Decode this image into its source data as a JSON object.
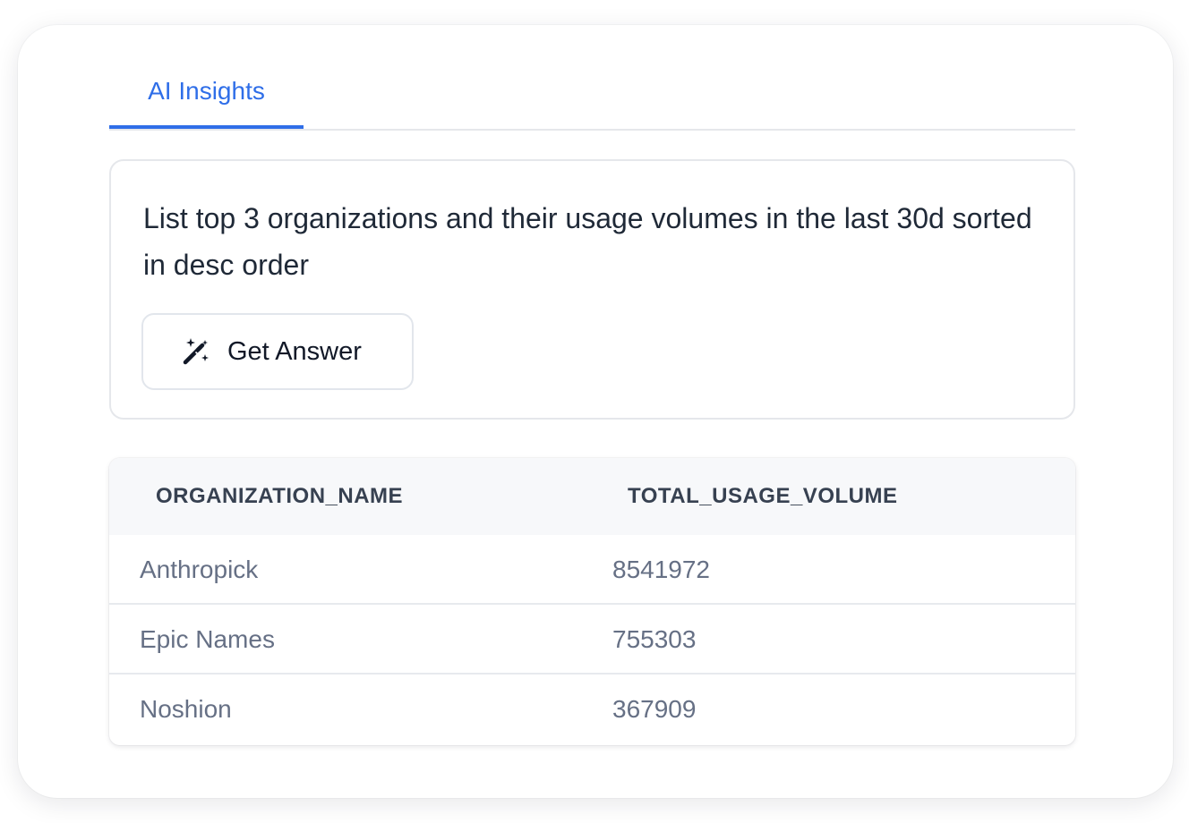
{
  "tabs": [
    {
      "label": "AI Insights",
      "active": true
    }
  ],
  "question": {
    "text": "List top 3 organizations and their usage volumes in the last 30d sorted in desc order",
    "button_label": "Get Answer",
    "button_icon": "magic-wand-sparkles-icon"
  },
  "results": {
    "columns": [
      "ORGANIZATION_NAME",
      "TOTAL_USAGE_VOLUME"
    ],
    "rows": [
      [
        "Anthropick",
        "8541972"
      ],
      [
        "Epic Names",
        "755303"
      ],
      [
        "Noshion",
        "367909"
      ]
    ]
  },
  "colors": {
    "accent": "#2f6ee8",
    "text_primary": "#1f2937",
    "text_muted": "#667085",
    "header_bg": "#f7f8fa",
    "border": "#e5e7eb"
  }
}
